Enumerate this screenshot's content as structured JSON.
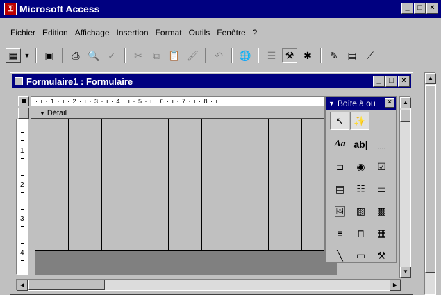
{
  "app": {
    "title": "Microsoft Access",
    "window_buttons": [
      "_",
      "□",
      "×"
    ]
  },
  "menu": {
    "items": [
      "Fichier",
      "Edition",
      "Affichage",
      "Insertion",
      "Format",
      "Outils",
      "Fenêtre",
      "?"
    ]
  },
  "toolbar": {
    "buttons": [
      "form-view-icon",
      "dropdown-arrow-icon",
      "save-icon",
      "print-icon",
      "print-preview-icon",
      "spelling-icon",
      "cut-icon",
      "copy-icon",
      "paste-icon",
      "format-painter-icon",
      "undo-icon",
      "insert-hyperlink-icon",
      "field-list-icon",
      "toolbox-icon",
      "autoformat-icon",
      "code-icon",
      "properties-icon",
      "build-icon"
    ]
  },
  "form_window": {
    "title": "Formulaire1 : Formulaire",
    "window_buttons": [
      "_",
      "□",
      "×"
    ],
    "section": "Détail",
    "hruler_text": "· ı · 1 · ı · 2 · ı · 3 · ı · 4 · ı · 5 · ı · 6 · ı · 7 · ı · 8 · ı",
    "vruler_numbers": [
      "1",
      "2",
      "3",
      "4"
    ]
  },
  "toolbox": {
    "title": "Boîte à ou",
    "close": "×",
    "tools": [
      [
        "select-objects-icon",
        "control-wizards-icon"
      ],
      [
        "label-icon",
        "textbox-icon",
        "option-group-icon"
      ],
      [
        "toggle-button-icon",
        "option-button-icon",
        "checkbox-icon"
      ],
      [
        "combo-box-icon",
        "list-box-icon",
        "command-button-icon"
      ],
      [
        "image-icon",
        "unbound-object-frame-icon",
        "bound-object-frame-icon"
      ],
      [
        "page-break-icon",
        "tab-control-icon",
        "subform-icon"
      ],
      [
        "line-icon",
        "rectangle-icon",
        "more-controls-icon"
      ]
    ],
    "label_text": "Aa",
    "textbox_text": "ab|"
  }
}
